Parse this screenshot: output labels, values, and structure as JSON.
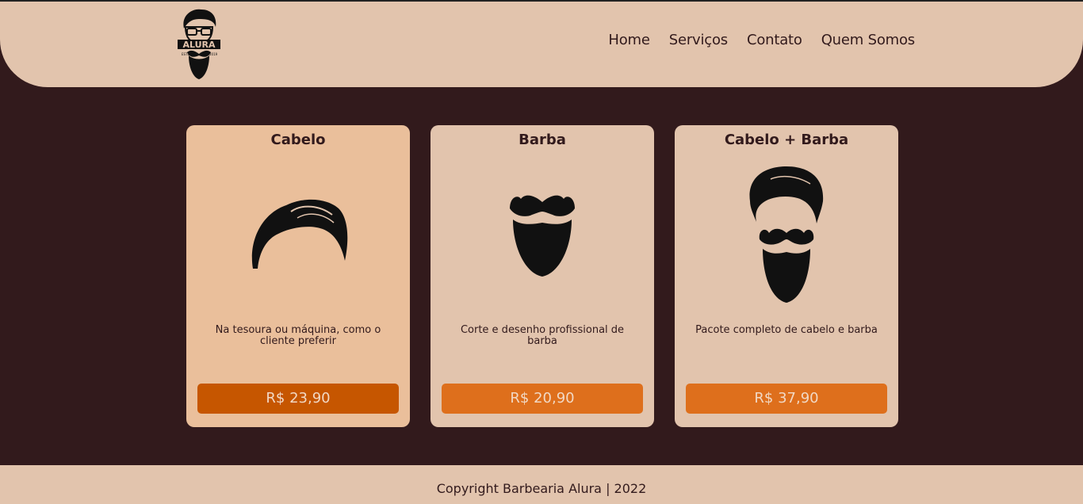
{
  "header": {
    "logo_text": "ALURA",
    "logo_left": "ESTD",
    "logo_right": "2019",
    "nav": [
      "Home",
      "Serviços",
      "Contato",
      "Quem Somos"
    ]
  },
  "cards": [
    {
      "title": "Cabelo",
      "description": "Na tesoura ou máquina, como o cliente preferir",
      "price": "R$ 23,90",
      "icon": "hair-icon"
    },
    {
      "title": "Barba",
      "description": "Corte e desenho profissional de barba",
      "price": "R$ 20,90",
      "icon": "beard-icon"
    },
    {
      "title": "Cabelo + Barba",
      "description": "Pacote completo de cabelo e barba",
      "price": "R$ 37,90",
      "icon": "hair-beard-icon"
    }
  ],
  "footer": {
    "text": "Copyright Barbearia Alura | 2022"
  },
  "colors": {
    "background": "#321a1c",
    "panel": "#e2c4ad",
    "accent": "#de6f1c",
    "accent_active": "#c65600",
    "card_active": "#eabf9b"
  }
}
